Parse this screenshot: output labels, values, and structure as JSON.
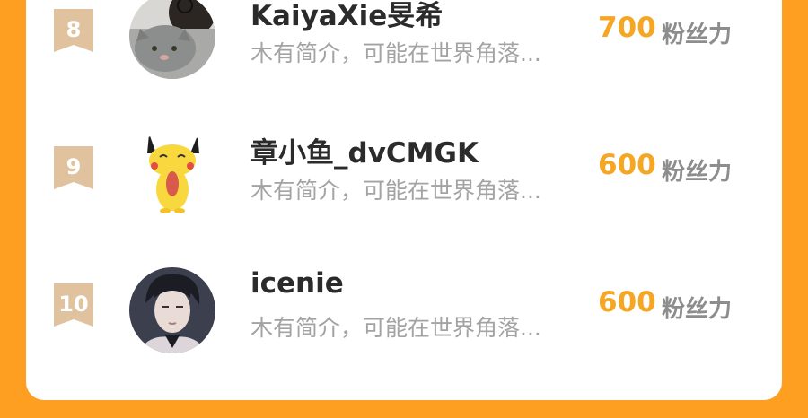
{
  "leaderboard": {
    "rows": [
      {
        "rank": "8",
        "name": "KaiyaXie旻希",
        "bio": "木有简介，可能在世界角落...",
        "score": "700",
        "unit": "粉丝力",
        "avatar": "avatar-with-cat"
      },
      {
        "rank": "9",
        "name": "章小鱼_dvCMGK",
        "bio": "木有简介，可能在世界角落...",
        "score": "600",
        "unit": "粉丝力",
        "avatar": "pikachu-avatar"
      },
      {
        "rank": "10",
        "name": "icenie",
        "bio": "木有简介，可能在世界角落...",
        "score": "600",
        "unit": "粉丝力",
        "avatar": "anime-boy-avatar"
      }
    ]
  },
  "colors": {
    "background": "#FF9F22",
    "card": "#FFFFFF",
    "score": "#F5A623",
    "rank_badge": "#E0C29F",
    "name": "#2B2B2B",
    "bio": "#A3A3A3",
    "unit": "#8D8D8D"
  }
}
